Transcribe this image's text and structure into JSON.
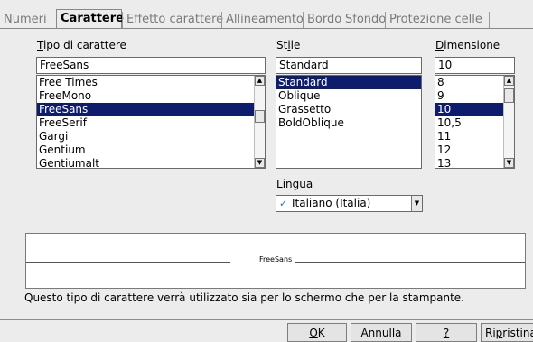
{
  "tabs": [
    {
      "label": "Numeri",
      "active": false
    },
    {
      "label": "Carattere",
      "active": true
    },
    {
      "label": "Effetto carattere",
      "active": false
    },
    {
      "label": "Allineamento",
      "active": false
    },
    {
      "label": "Bordo",
      "active": false
    },
    {
      "label": "Sfondo",
      "active": false
    },
    {
      "label": "Protezione celle",
      "active": false
    }
  ],
  "font": {
    "label_first": "T",
    "label_rest": "ipo di carattere",
    "value": "FreeSans",
    "items": [
      "Free Times",
      "FreeMono",
      "FreeSans",
      "FreeSerif",
      "Gargi",
      "Gentium",
      "Gentiumalt"
    ],
    "selected": "FreeSans"
  },
  "style": {
    "label_pre": "St",
    "label_u": "i",
    "label_post": "le",
    "value": "Standard",
    "items": [
      "Standard",
      "Oblique",
      "Grassetto",
      "BoldOblique"
    ],
    "selected": "Standard"
  },
  "size": {
    "label_first": "D",
    "label_rest": "imensione",
    "value": "10",
    "items": [
      "8",
      "9",
      "10",
      "10,5",
      "11",
      "12",
      "13"
    ],
    "selected": "10"
  },
  "language": {
    "label_first": "L",
    "label_rest": "ingua",
    "value": "Italiano (Italia)",
    "icon": "spellcheck-icon"
  },
  "preview": {
    "sample_text": "FreeSans"
  },
  "info_text": "Questo tipo di carattere verrà utilizzato sia per lo schermo che per la stampante.",
  "buttons": {
    "ok_first": "O",
    "ok_rest": "K",
    "cancel": "Annulla",
    "help": "?",
    "reset_pre": "Ri",
    "reset_u": "p",
    "reset_post": "ristina"
  },
  "colors": {
    "selection": "#0d1c6d",
    "dialog_bg": "#ececec"
  }
}
